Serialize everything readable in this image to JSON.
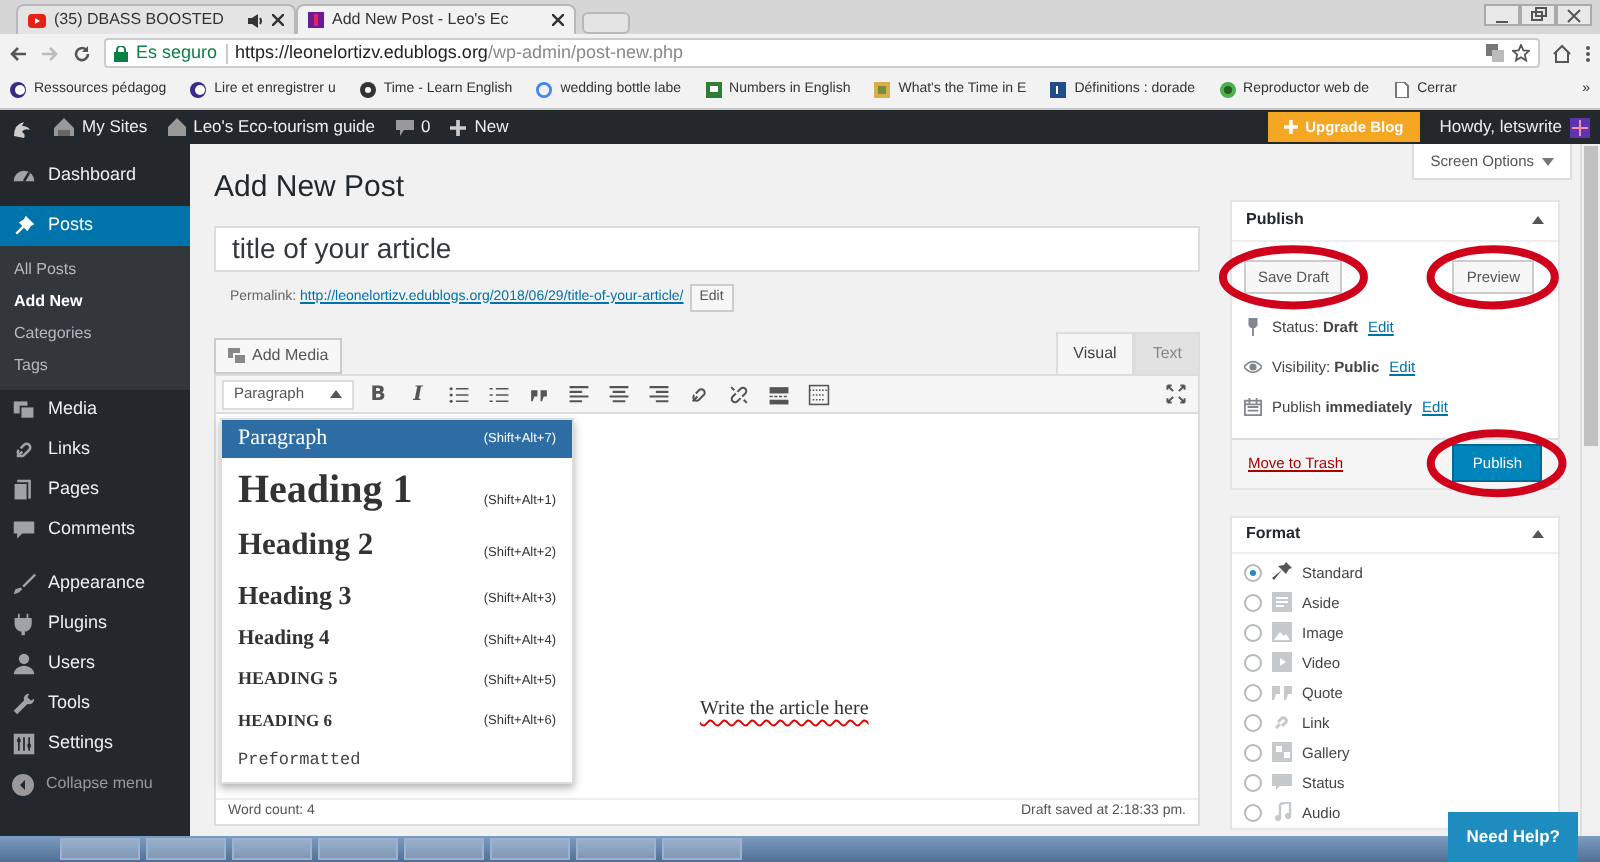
{
  "browser": {
    "tabs": [
      {
        "title": "(35) DBASS BOOSTED",
        "selected": false
      },
      {
        "title": "Add New Post - Leo's Ec",
        "selected": true
      }
    ],
    "secure_label": "Es seguro",
    "url_host": "https://leonelortizv.edublogs.org",
    "url_path": "/wp-admin/post-new.php",
    "bookmarks": [
      "Ressources pédagog",
      "Lire et enregistrer u",
      "Time - Learn English",
      "wedding bottle labe",
      "Numbers in English",
      "What's the Time in E",
      "Définitions : dorade",
      "Reproductor web de",
      "Cerrar"
    ],
    "bookmarks_more": "»"
  },
  "admin_bar": {
    "my_sites": "My Sites",
    "site_name": "Leo's Eco-tourism guide",
    "comment_count": "0",
    "new_label": "New",
    "upgrade_label": "Upgrade Blog",
    "greeting": "Howdy, letswrite"
  },
  "sidebar": {
    "items": [
      {
        "label": "Dashboard",
        "selected": false
      },
      {
        "label": "Posts",
        "selected": true,
        "children": [
          {
            "label": "All Posts",
            "selected": false
          },
          {
            "label": "Add New",
            "selected": true
          },
          {
            "label": "Categories",
            "selected": false
          },
          {
            "label": "Tags",
            "selected": false
          }
        ]
      },
      {
        "label": "Media",
        "selected": false
      },
      {
        "label": "Links",
        "selected": false
      },
      {
        "label": "Pages",
        "selected": false
      },
      {
        "label": "Comments",
        "selected": false
      },
      {
        "label": "Appearance",
        "selected": false
      },
      {
        "label": "Plugins",
        "selected": false
      },
      {
        "label": "Users",
        "selected": false
      },
      {
        "label": "Tools",
        "selected": false
      },
      {
        "label": "Settings",
        "selected": false
      }
    ],
    "collapse_label": "Collapse menu"
  },
  "page": {
    "screen_options": "Screen Options",
    "heading": "Add New Post"
  },
  "editor": {
    "title_value": "title of your article",
    "permalink_label": "Permalink:",
    "permalink_url": "http://leonelortizv.edublogs.org/2018/06/29/title-of-your-article/",
    "permalink_edit": "Edit",
    "add_media": "Add Media",
    "mode_tabs": [
      {
        "label": "Visual",
        "selected": true
      },
      {
        "label": "Text",
        "selected": false
      }
    ],
    "format_select": "Paragraph",
    "bold_button": "B",
    "italic_button": "I",
    "format_menu": {
      "expanded": true,
      "items": [
        {
          "kind": "p",
          "label": "Paragraph",
          "shortcut": "(Shift+Alt+7)",
          "selected": true
        },
        {
          "kind": "h1",
          "label": "Heading 1",
          "shortcut": "(Shift+Alt+1)",
          "selected": false
        },
        {
          "kind": "h2",
          "label": "Heading 2",
          "shortcut": "(Shift+Alt+2)",
          "selected": false
        },
        {
          "kind": "h3",
          "label": "Heading 3",
          "shortcut": "(Shift+Alt+3)",
          "selected": false
        },
        {
          "kind": "h4",
          "label": "Heading 4",
          "shortcut": "(Shift+Alt+4)",
          "selected": false
        },
        {
          "kind": "h5",
          "label": "HEADING 5",
          "shortcut": "(Shift+Alt+5)",
          "selected": false
        },
        {
          "kind": "h6",
          "label": "HEADING 6",
          "shortcut": "(Shift+Alt+6)",
          "selected": false
        },
        {
          "kind": "pre",
          "label": "Preformatted",
          "selected": false
        }
      ]
    },
    "body_text": "Write the article here",
    "misspelled": true,
    "word_count": "Word count: 4",
    "autosave": "Draft saved at 2:18:33 pm."
  },
  "publish": {
    "title": "Publish",
    "save_draft": {
      "label": "Save Draft",
      "circled": true
    },
    "preview": {
      "label": "Preview",
      "circled": true
    },
    "rows": [
      {
        "text": "Status: **Draft**",
        "link": "Edit"
      },
      {
        "text": "Visibility: **Public**",
        "link": "Edit"
      },
      {
        "text": "Publish **immediately**",
        "link": "Edit"
      }
    ],
    "trash": "Move to Trash",
    "publish_button": {
      "label": "Publish",
      "circled": true
    }
  },
  "format": {
    "title": "Format",
    "options": [
      {
        "label": "Standard",
        "selected": true
      },
      {
        "label": "Aside",
        "selected": false
      },
      {
        "label": "Image",
        "selected": false
      },
      {
        "label": "Video",
        "selected": false
      },
      {
        "label": "Quote",
        "selected": false
      },
      {
        "label": "Link",
        "selected": false
      },
      {
        "label": "Gallery",
        "selected": false
      },
      {
        "label": "Status",
        "selected": false
      },
      {
        "label": "Audio",
        "selected": false
      }
    ]
  },
  "help_button": "Need Help?"
}
